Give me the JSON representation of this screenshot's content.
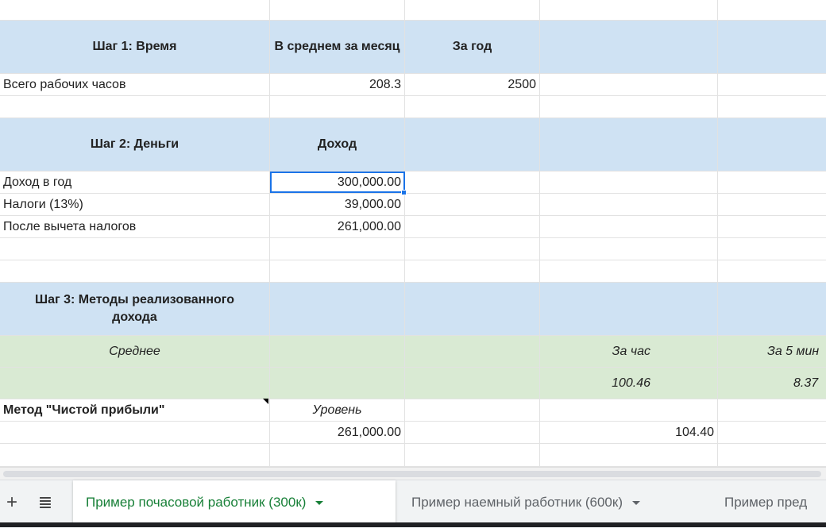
{
  "step1": {
    "header": {
      "title": "Шаг 1: Время",
      "col_month": "В среднем за месяц",
      "col_year": "За год"
    },
    "row": {
      "label": "Всего рабочих часов",
      "month": "208.3",
      "year": "2500"
    }
  },
  "step2": {
    "header": {
      "title": "Шаг 2: Деньги",
      "col_income": "Доход"
    },
    "rows": [
      {
        "label": "Доход в год",
        "value": "300,000.00"
      },
      {
        "label": "Налоги (13%)",
        "value": "39,000.00"
      },
      {
        "label": "После вычета налогов",
        "value": "261,000.00"
      }
    ]
  },
  "step3": {
    "header": {
      "title": "Шаг 3: Методы реализованного дохода"
    },
    "avg_row": {
      "label": "Среднее",
      "per_hour": "За час",
      "per_5min": "За 5 мин"
    },
    "avg_values": {
      "per_hour": "100.46",
      "per_5min": "8.37"
    },
    "method": {
      "label": "Метод \"Чистой прибыли\"",
      "level": "Уровень",
      "value": "261,000.00",
      "per_hour": "104.40"
    }
  },
  "tabs": {
    "add_label": "+",
    "list_label": "≣",
    "items": [
      {
        "label": "Пример почасовой работник (300к)"
      },
      {
        "label": "Пример наемный работник (600к)"
      },
      {
        "label": "Пример пред"
      }
    ]
  },
  "colors": {
    "header_blue": "#cfe2f3",
    "avg_green": "#d9ead3",
    "selection": "#1a73e8",
    "active_tab": "#188038"
  }
}
